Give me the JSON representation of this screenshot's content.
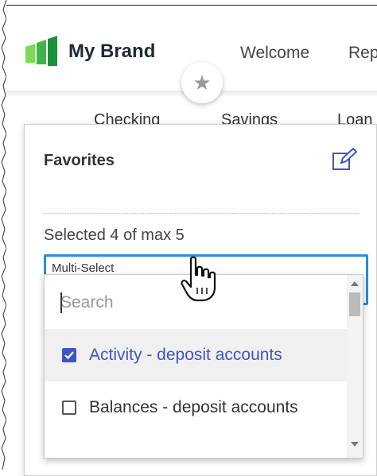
{
  "header": {
    "brand": "My Brand",
    "nav": [
      "Welcome",
      "Rep"
    ]
  },
  "subnav": [
    "Checking",
    "Savings",
    "Loan"
  ],
  "favorites": {
    "title": "Favorites",
    "selected_text": "Selected 4 of max 5",
    "multiselect_label": "Multi-Select",
    "search_placeholder": "Search",
    "options": [
      {
        "label": "Activity - deposit accounts",
        "checked": true
      },
      {
        "label": "Balances - deposit accounts",
        "checked": false
      }
    ]
  },
  "colors": {
    "brand_green": "#3cb54a",
    "accent_blue": "#3e56c4",
    "focus_blue": "#2a8be0"
  },
  "icons": {
    "star": "star-icon",
    "edit": "edit-icon",
    "cursor": "hand-cursor-icon"
  }
}
